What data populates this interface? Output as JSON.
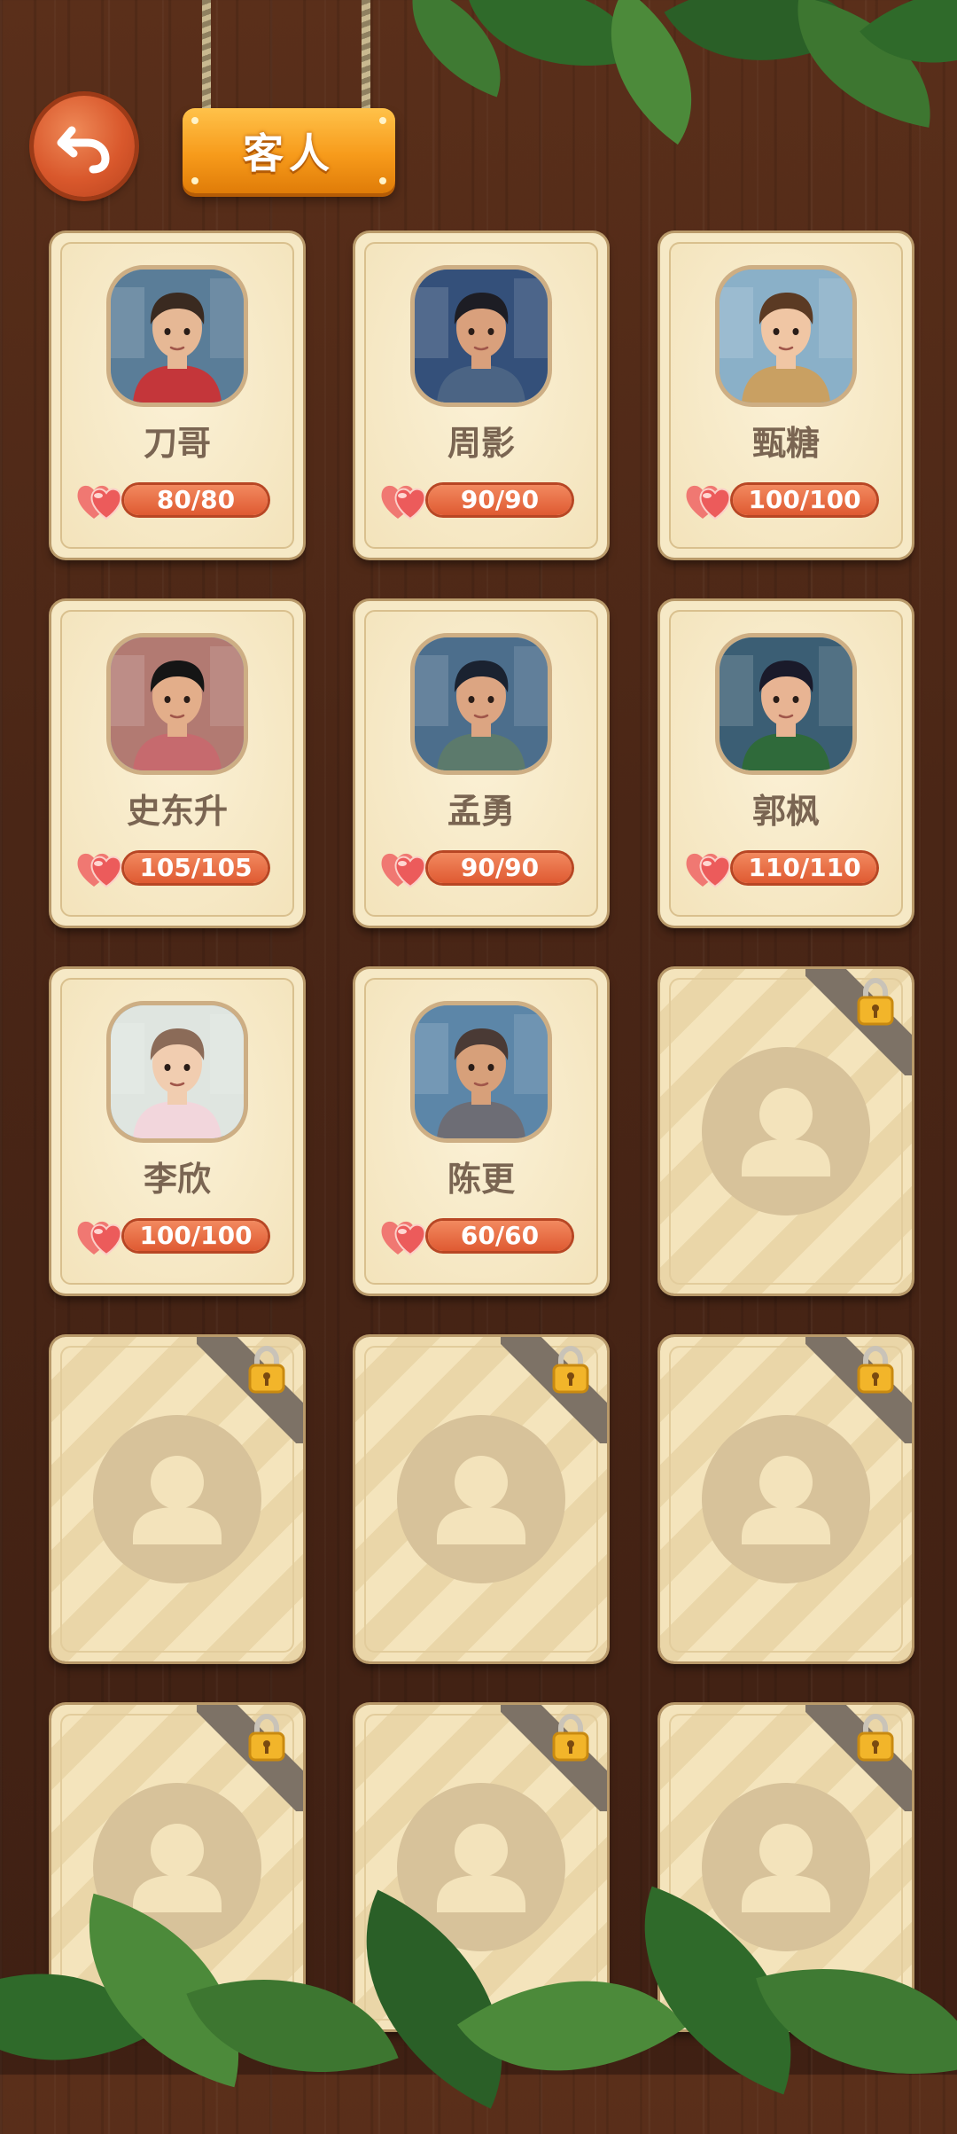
{
  "header": {
    "title": "客人",
    "back_icon": "back-arrow-icon"
  },
  "colors": {
    "accent_orange": "#f79b1b",
    "hp_pill": "#df5a32",
    "card_bg": "#f6e9c6",
    "name_text": "#7a6552",
    "wood": "#4a2616"
  },
  "guests": [
    {
      "name": "刀哥",
      "hp": "80/80",
      "locked": false
    },
    {
      "name": "周影",
      "hp": "90/90",
      "locked": false
    },
    {
      "name": "甄糖",
      "hp": "100/100",
      "locked": false
    },
    {
      "name": "史东升",
      "hp": "105/105",
      "locked": false
    },
    {
      "name": "孟勇",
      "hp": "90/90",
      "locked": false
    },
    {
      "name": "郭枫",
      "hp": "110/110",
      "locked": false
    },
    {
      "name": "李欣",
      "hp": "100/100",
      "locked": false
    },
    {
      "name": "陈更",
      "hp": "60/60",
      "locked": false
    },
    {
      "locked": true
    },
    {
      "locked": true
    },
    {
      "locked": true
    },
    {
      "locked": true
    },
    {
      "locked": true
    },
    {
      "locked": true
    },
    {
      "locked": true
    }
  ]
}
